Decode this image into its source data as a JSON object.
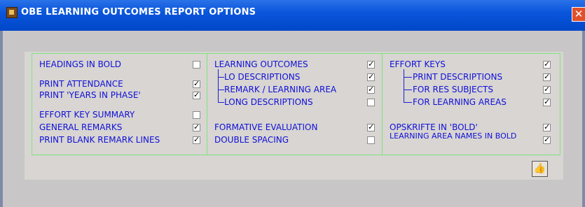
{
  "window": {
    "title": "OBE LEARNING OUTCOMES REPORT OPTIONS"
  },
  "col1": {
    "headings_bold": {
      "label": "HEADINGS IN BOLD",
      "checked": false
    },
    "print_attendance": {
      "label": "PRINT ATTENDANCE",
      "checked": true
    },
    "print_years_in_phase": {
      "label": "PRINT 'YEARS IN PHASE'",
      "checked": true
    },
    "effort_key_summary": {
      "label": "EFFORT KEY SUMMARY",
      "checked": false
    },
    "general_remarks": {
      "label": "GENERAL REMARKS",
      "checked": true
    },
    "print_blank_remark_lines": {
      "label": "PRINT BLANK REMARK LINES",
      "checked": true
    }
  },
  "col2": {
    "learning_outcomes": {
      "label": "LEARNING OUTCOMES",
      "checked": true
    },
    "lo_descriptions": {
      "label": "LO DESCRIPTIONS",
      "checked": true
    },
    "remark_learning_area": {
      "label": "REMARK / LEARNING AREA",
      "checked": true
    },
    "long_descriptions": {
      "label": "LONG DESCRIPTIONS",
      "checked": false
    },
    "formative_evaluation": {
      "label": "FORMATIVE EVALUATION",
      "checked": true
    },
    "double_spacing": {
      "label": "DOUBLE SPACING",
      "checked": false
    }
  },
  "col3": {
    "effort_keys": {
      "label": "EFFORT KEYS",
      "checked": true
    },
    "print_descriptions": {
      "label": "PRINT DESCRIPTIONS",
      "checked": true
    },
    "for_res_subjects": {
      "label": "FOR RES SUBJECTS",
      "checked": true
    },
    "for_learning_areas": {
      "label": "FOR LEARNING AREAS",
      "checked": true
    },
    "opskrifte_in_bold": {
      "label": "OPSKRIFTE IN 'BOLD'",
      "checked": true
    },
    "learning_area_names_in_bold": {
      "label": "LEARNING AREA NAMES IN BOLD",
      "checked": true
    }
  },
  "icons": {
    "app": "app-icon",
    "close": "close-icon",
    "ok": "thumbs-up-icon"
  }
}
